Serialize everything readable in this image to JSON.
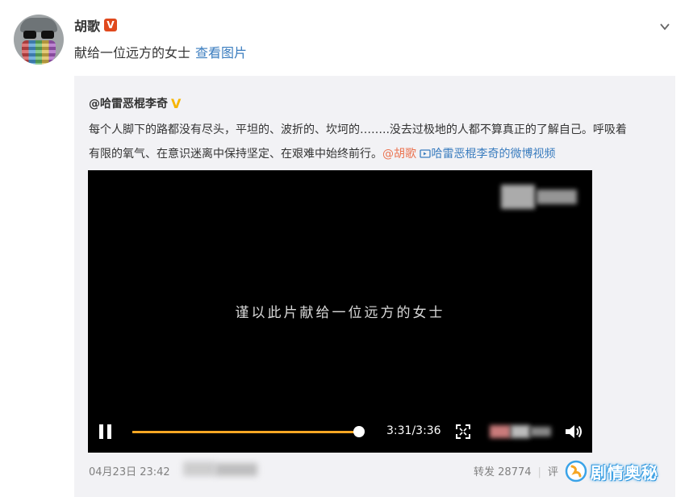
{
  "post": {
    "author": "胡歌",
    "verified_badge": "V",
    "text": "献给一位远方的女士",
    "view_image_link": "查看图片"
  },
  "repost": {
    "author": "@哈雷恶棍李奇",
    "text_line1": "每个人脚下的路都没有尽头，平坦的、波折的、坎坷的……..没去过极地的人都不算真正的了解自己。呼吸着",
    "text_line2": "有限的氧气、在意识迷离中保持坚定、在艰难中始终前行。",
    "mention": "@胡歌",
    "video_link": "哈雷恶棍李奇的微博视频",
    "video": {
      "caption": "谨以此片献给一位远方的女士",
      "time": "3:31/3:36",
      "progress": 0.98
    },
    "footer": {
      "date": "04月23日 23:42",
      "repost_label": "转发",
      "repost_count": "28774",
      "comment_label": "评"
    }
  },
  "watermark": {
    "text": "剧情奥秘"
  },
  "colors": {
    "accent": "#f6a623",
    "link": "#3b7dbf",
    "mention": "#eb7350",
    "verified": "#f7b500"
  }
}
